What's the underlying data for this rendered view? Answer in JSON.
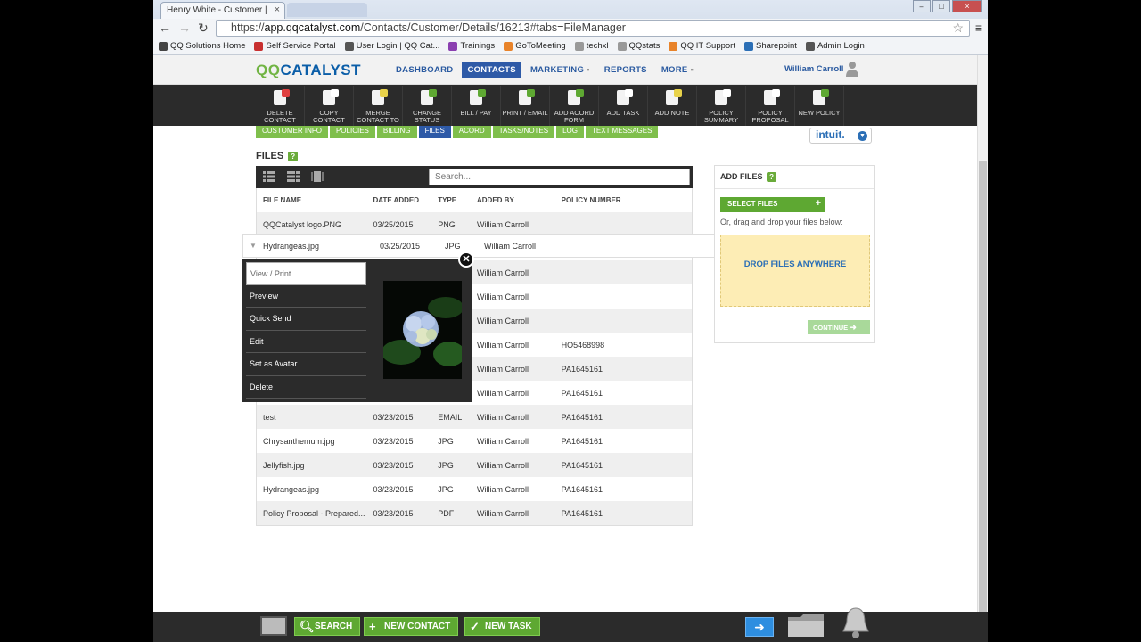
{
  "browser": {
    "tab_title": "Henry White - Customer |",
    "url_prefix": "https://",
    "url_host": "app.qqcatalyst.com",
    "url_path": "/Contacts/Customer/Details/16213#tabs=FileManager",
    "bookmarks": [
      {
        "label": "QQ Solutions Home",
        "color": "#444"
      },
      {
        "label": "Self Service Portal",
        "color": "#c83030"
      },
      {
        "label": "User Login | QQ Cat...",
        "color": "#555"
      },
      {
        "label": "Trainings",
        "color": "#8a3fb0"
      },
      {
        "label": "GoToMeeting",
        "color": "#e8832a"
      },
      {
        "label": "techxl",
        "color": "#999"
      },
      {
        "label": "QQstats",
        "color": "#999"
      },
      {
        "label": "QQ IT Support",
        "color": "#e8832a"
      },
      {
        "label": "Sharepoint",
        "color": "#2b6fb6"
      },
      {
        "label": "Admin Login",
        "color": "#555"
      }
    ]
  },
  "app": {
    "logo": {
      "qq": "QQ",
      "catalyst": "CATALYST"
    },
    "nav": [
      "DASHBOARD",
      "CONTACTS",
      "MARKETING",
      "REPORTS",
      "MORE"
    ],
    "nav_dropdown_marker": "▪",
    "active_nav": "CONTACTS",
    "user_name": "William Carroll",
    "actions": [
      {
        "label": "DELETE CONTACT",
        "icon": "delete-contact-icon"
      },
      {
        "label": "COPY CONTACT",
        "icon": "copy-contact-icon"
      },
      {
        "label": "MERGE CONTACT TO",
        "icon": "merge-contact-icon"
      },
      {
        "label": "CHANGE STATUS",
        "icon": "change-status-icon"
      },
      {
        "label": "BILL / PAY",
        "icon": "bill-pay-icon"
      },
      {
        "label": "PRINT / EMAIL",
        "icon": "print-email-icon"
      },
      {
        "label": "ADD ACORD FORM",
        "icon": "add-acord-icon"
      },
      {
        "label": "ADD TASK",
        "icon": "add-task-icon"
      },
      {
        "label": "ADD NOTE",
        "icon": "add-note-icon"
      },
      {
        "label": "POLICY SUMMARY",
        "icon": "policy-summary-icon"
      },
      {
        "label": "POLICY PROPOSAL",
        "icon": "policy-proposal-icon"
      },
      {
        "label": "NEW POLICY",
        "icon": "new-policy-icon"
      }
    ],
    "subtabs": [
      "CUSTOMER INFO",
      "POLICIES",
      "BILLING",
      "FILES",
      "ACORD",
      "TASKS/NOTES",
      "LOG",
      "TEXT MESSAGES"
    ],
    "active_subtab": "FILES",
    "intuit_label": "intuit."
  },
  "files": {
    "title": "FILES",
    "help": "?",
    "search_placeholder": "Search...",
    "columns": [
      "FILE NAME",
      "DATE ADDED",
      "TYPE",
      "ADDED BY",
      "POLICY NUMBER"
    ],
    "rows": [
      [
        "QQCatalyst logo.PNG",
        "03/25/2015",
        "PNG",
        "William Carroll",
        ""
      ],
      [
        "",
        "",
        "",
        "",
        ""
      ],
      [
        "",
        "",
        "",
        "William Carroll",
        ""
      ],
      [
        "",
        "",
        "",
        "William Carroll",
        ""
      ],
      [
        "",
        "",
        "",
        "William Carroll",
        ""
      ],
      [
        "",
        "",
        "",
        "William Carroll",
        "HO5468998"
      ],
      [
        "",
        "",
        "",
        "William Carroll",
        "PA1645161"
      ],
      [
        "",
        "",
        "",
        "William Carroll",
        "PA1645161"
      ],
      [
        "test",
        "03/23/2015",
        "EMAIL",
        "William Carroll",
        "PA1645161"
      ],
      [
        "Chrysanthemum.jpg",
        "03/23/2015",
        "JPG",
        "William Carroll",
        "PA1645161"
      ],
      [
        "Jellyfish.jpg",
        "03/23/2015",
        "JPG",
        "William Carroll",
        "PA1645161"
      ],
      [
        "Hydrangeas.jpg",
        "03/23/2015",
        "JPG",
        "William Carroll",
        "PA1645161"
      ],
      [
        "Policy Proposal - Prepared...",
        "03/23/2015",
        "PDF",
        "William Carroll",
        "PA1645161"
      ]
    ],
    "expanded_row": [
      "Hydrangeas.jpg",
      "03/25/2015",
      "JPG",
      "William Carroll",
      ""
    ],
    "context_menu": [
      "View / Print",
      "Preview",
      "Quick Send",
      "Edit",
      "Set as Avatar",
      "Delete"
    ],
    "close_glyph": "✕"
  },
  "add_files": {
    "title": "ADD FILES",
    "help": "?",
    "select_button": "SELECT FILES",
    "select_plus": "+",
    "drag_text": "Or, drag and drop your files below:",
    "dropzone": "DROP FILES ANYWHERE",
    "continue": "CONTINUE"
  },
  "bottombar": {
    "search": "SEARCH",
    "new_contact": "NEW CONTACT",
    "new_task": "NEW TASK"
  }
}
